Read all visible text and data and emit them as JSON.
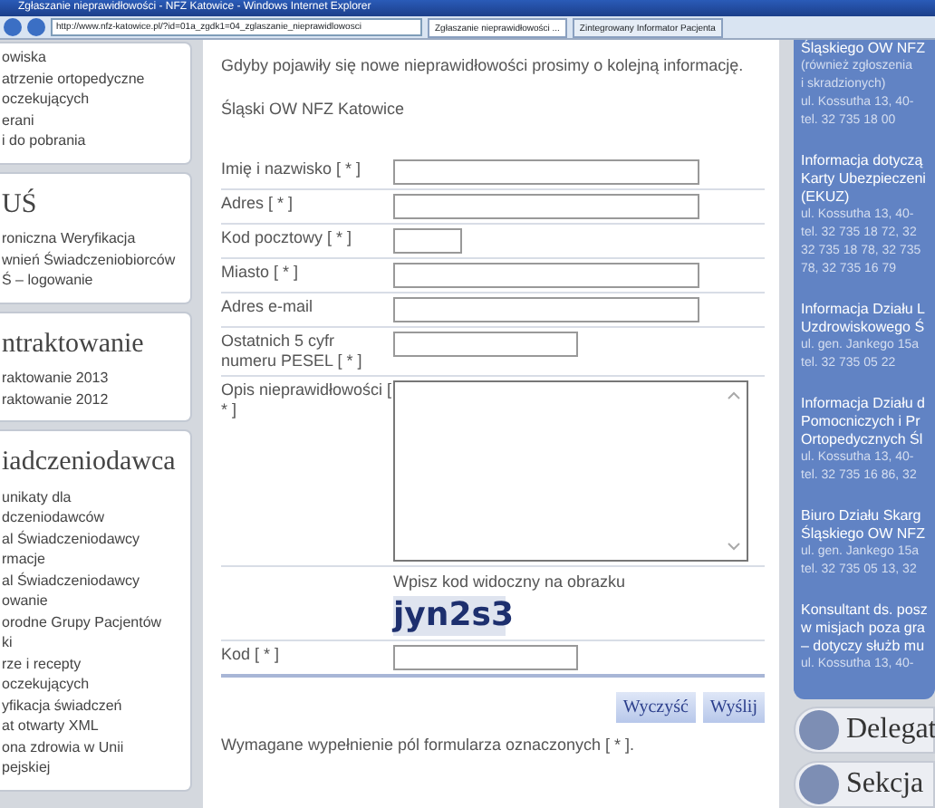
{
  "window": {
    "title": "Zgłaszanie nieprawidłowości - NFZ Katowice - Windows Internet Explorer"
  },
  "address_bar": {
    "url": "http://www.nfz-katowice.pl/?id=01a_zgdk1=04_zglaszanie_nieprawidlowosci"
  },
  "tabs": [
    {
      "label": "Zgłaszanie nieprawidłowości ...",
      "selected": true
    },
    {
      "label": "Zintegrowany Informator Pacjenta",
      "selected": false
    }
  ],
  "left_sidebar": {
    "sections": [
      {
        "items": [
          "owiska",
          "atrzenie ortopedyczne",
          "oczekujących",
          "erani",
          "i do pobrania"
        ]
      },
      {
        "heading": "UŚ",
        "items": [
          "roniczna Weryfikacja",
          "wnień Świadczeniobiorców",
          "Ś – logowanie"
        ]
      },
      {
        "heading": "ntraktowanie",
        "items": [
          "raktowanie 2013",
          "raktowanie 2012"
        ]
      },
      {
        "heading": "iadczeniodawca",
        "items": [
          "unikaty dla",
          "dczeniodawców",
          "al Świadczeniodawcy",
          "rmacje",
          "al Świadczeniodawcy",
          "owanie",
          "orodne Grupy Pacjentów",
          "ki",
          "rze i recepty",
          "oczekujących",
          "yfikacja świadczeń",
          "at otwarty XML",
          "ona zdrowia w Unii",
          "pejskiej"
        ]
      }
    ]
  },
  "main": {
    "intro": "Gdyby pojawiły się nowe nieprawidłowości prosimy o kolejną informację.",
    "signature": "Śląski OW NFZ Katowice",
    "fields": [
      {
        "label": "Imię i nazwisko [ * ]",
        "kind": "long"
      },
      {
        "label": "Adres [ * ]",
        "kind": "long"
      },
      {
        "label": "Kod pocztowy [ * ]",
        "kind": "short"
      },
      {
        "label": "Miasto [ * ]",
        "kind": "long"
      },
      {
        "label": "Adres e-mail",
        "kind": "long"
      },
      {
        "label": "Ostatnich 5 cyfr numeru PESEL [ * ]",
        "kind": "medium"
      },
      {
        "label": "Opis nieprawidłowości [ * ]",
        "kind": "textarea"
      }
    ],
    "captcha": {
      "prompt": "Wpisz kod widoczny na obrazku",
      "code": "jyn2s3"
    },
    "code_field": {
      "label": "Kod [ * ]"
    },
    "buttons": [
      "Wyczyść",
      "Wyślij"
    ],
    "footnote": "Wymagane wypełnienie pól formularza oznaczonych [ * ]."
  },
  "right_panel": {
    "contacts": [
      {
        "title": [
          "Śląskiego OW NFZ"
        ],
        "details": [
          "(również zgłoszenia",
          "i skradzionych)",
          "ul. Kossutha 13, 40-",
          "tel. 32 735 18 00"
        ]
      },
      {
        "title": [
          "Informacja dotyczą",
          "Karty Ubezpieczeni",
          "(EKUZ)"
        ],
        "details": [
          "ul. Kossutha 13, 40-",
          "tel. 32 735 18 72, 32",
          "32 735 18 78, 32 735",
          "78, 32 735 16 79"
        ]
      },
      {
        "title": [
          "Informacja Działu L",
          "Uzdrowiskowego Ś"
        ],
        "details": [
          "ul. gen. Jankego 15a",
          "tel. 32 735 05 22"
        ]
      },
      {
        "title": [
          "Informacja Działu d",
          "Pomocniczych i Pr",
          "Ortopedycznych Śl"
        ],
        "details": [
          "ul. Kossutha 13, 40-",
          "tel. 32 735 16 86, 32"
        ]
      },
      {
        "title": [
          "Biuro Działu Skarg",
          "Śląskiego OW NFZ"
        ],
        "details": [
          "ul. gen. Jankego 15a",
          "tel. 32 735 05 13, 32"
        ]
      },
      {
        "title": [
          "Konsultant ds. posz",
          "w misjach poza gra",
          "– dotyczy służb mu"
        ],
        "details": [
          "ul. Kossutha 13, 40-"
        ]
      }
    ],
    "links": [
      "Delegat",
      "Sekcja"
    ]
  }
}
